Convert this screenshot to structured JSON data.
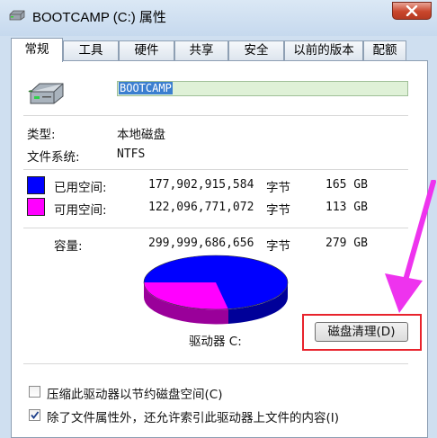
{
  "window": {
    "title": "BOOTCAMP (C:) 属性"
  },
  "tabs": [
    {
      "label": "常规"
    },
    {
      "label": "工具"
    },
    {
      "label": "硬件"
    },
    {
      "label": "共享"
    },
    {
      "label": "安全"
    },
    {
      "label": "以前的版本"
    },
    {
      "label": "配额"
    }
  ],
  "general": {
    "volume_name": "BOOTCAMP",
    "type_label": "类型:",
    "type_value": "本地磁盘",
    "fs_label": "文件系统:",
    "fs_value": "NTFS",
    "used": {
      "label": "已用空间:",
      "bytes": "177,902,915,584",
      "unit": "字节",
      "size": "165 GB",
      "color": "#0000ff"
    },
    "free": {
      "label": "可用空间:",
      "bytes": "122,096,771,072",
      "unit": "字节",
      "size": "113 GB",
      "color": "#ff00ff"
    },
    "capacity": {
      "label": "容量:",
      "bytes": "299,999,686,656",
      "unit": "字节",
      "size": "279 GB"
    },
    "drive_label": "驱动器 C:",
    "disk_cleanup_button": "磁盘清理(D)",
    "compress_label": "压缩此驱动器以节约磁盘空间(C)",
    "compress_checked": false,
    "index_label": "除了文件属性外，还允许索引此驱动器上文件的内容(I)",
    "index_checked": true
  },
  "annotation": {
    "arrow_color": "#ee33ee",
    "highlight_color": "#e8232c"
  }
}
